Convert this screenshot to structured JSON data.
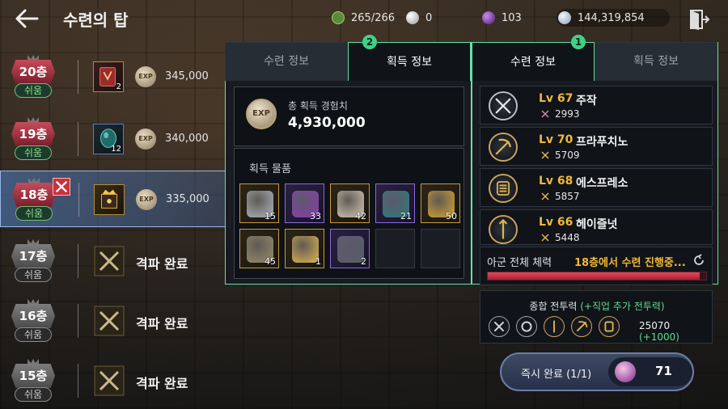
{
  "topbar": {
    "title": "수련의 탑",
    "resources": [
      {
        "icon": "stamina-icon",
        "value": "265/266"
      },
      {
        "icon": "pearl-icon",
        "value": "0"
      },
      {
        "icon": "purple-gem-icon",
        "value": "103"
      },
      {
        "icon": "silver-coin-icon",
        "value": "144,319,854"
      }
    ]
  },
  "floors": [
    {
      "floor": "20층",
      "difficulty": "쉬움",
      "reward_count": "2",
      "exp": "345,000",
      "status": ""
    },
    {
      "floor": "19층",
      "difficulty": "쉬움",
      "reward_count": "12",
      "exp": "340,000",
      "status": ""
    },
    {
      "floor": "18층",
      "difficulty": "쉬움",
      "reward_count": "",
      "exp": "335,000",
      "status": ""
    },
    {
      "floor": "17층",
      "difficulty": "쉬움",
      "reward_count": "",
      "exp": "",
      "status": "격파 완료"
    },
    {
      "floor": "16층",
      "difficulty": "쉬움",
      "reward_count": "",
      "exp": "",
      "status": "격파 완료"
    },
    {
      "floor": "15층",
      "difficulty": "쉬움",
      "reward_count": "",
      "exp": "",
      "status": "격파 완료"
    }
  ],
  "exp_icon_text": "EXP",
  "mid_panel": {
    "tabs": [
      "수련 정보",
      "획득 정보"
    ],
    "marker": "2",
    "total_exp_label": "총 획득 경험치",
    "total_exp_value": "4,930,000",
    "loot_label": "획득 물품",
    "loot": [
      {
        "count": "15",
        "rarity": "gold",
        "color": "#b0b7c2"
      },
      {
        "count": "33",
        "rarity": "purple",
        "color": "#8b3fb0"
      },
      {
        "count": "42",
        "rarity": "gold",
        "color": "#d8ccb8"
      },
      {
        "count": "21",
        "rarity": "purple",
        "color": "#2f7d7a"
      },
      {
        "count": "50",
        "rarity": "gold",
        "color": "#d9a531"
      },
      {
        "count": "45",
        "rarity": "gold",
        "color": "#9c8c6e"
      },
      {
        "count": "1",
        "rarity": "gold",
        "color": "#e0b650"
      },
      {
        "count": "2",
        "rarity": "purple",
        "color": "#5b5f6a"
      },
      {
        "count": "",
        "rarity": "empty",
        "color": ""
      },
      {
        "count": "",
        "rarity": "empty",
        "color": ""
      }
    ]
  },
  "right_panel": {
    "tabs": [
      "수련 정보",
      "획득 정보"
    ],
    "marker": "1",
    "heroes": [
      {
        "level": "Lv 67",
        "name": "주작",
        "power": "2993",
        "icon": "crossed-blades-icon"
      },
      {
        "level": "Lv 70",
        "name": "프라푸치노",
        "power": "5709",
        "icon": "scythe-icon"
      },
      {
        "level": "Lv 68",
        "name": "에스프레소",
        "power": "5857",
        "icon": "gauntlet-icon"
      },
      {
        "level": "Lv 66",
        "name": "헤이즐넛",
        "power": "5448",
        "icon": "spear-icon"
      }
    ],
    "hp_label": "아군 전체 체력",
    "hp_status": "18층에서 수련 진행중...",
    "hp_fraction": 0.97,
    "cp_label": "종합 전투력",
    "cp_bonus_label": "(+직업 추가 전투력)",
    "cp_value": "25070",
    "cp_plus": "(+1000)",
    "complete_button": "즉시 완료 (1/1)",
    "complete_cost": "71"
  }
}
